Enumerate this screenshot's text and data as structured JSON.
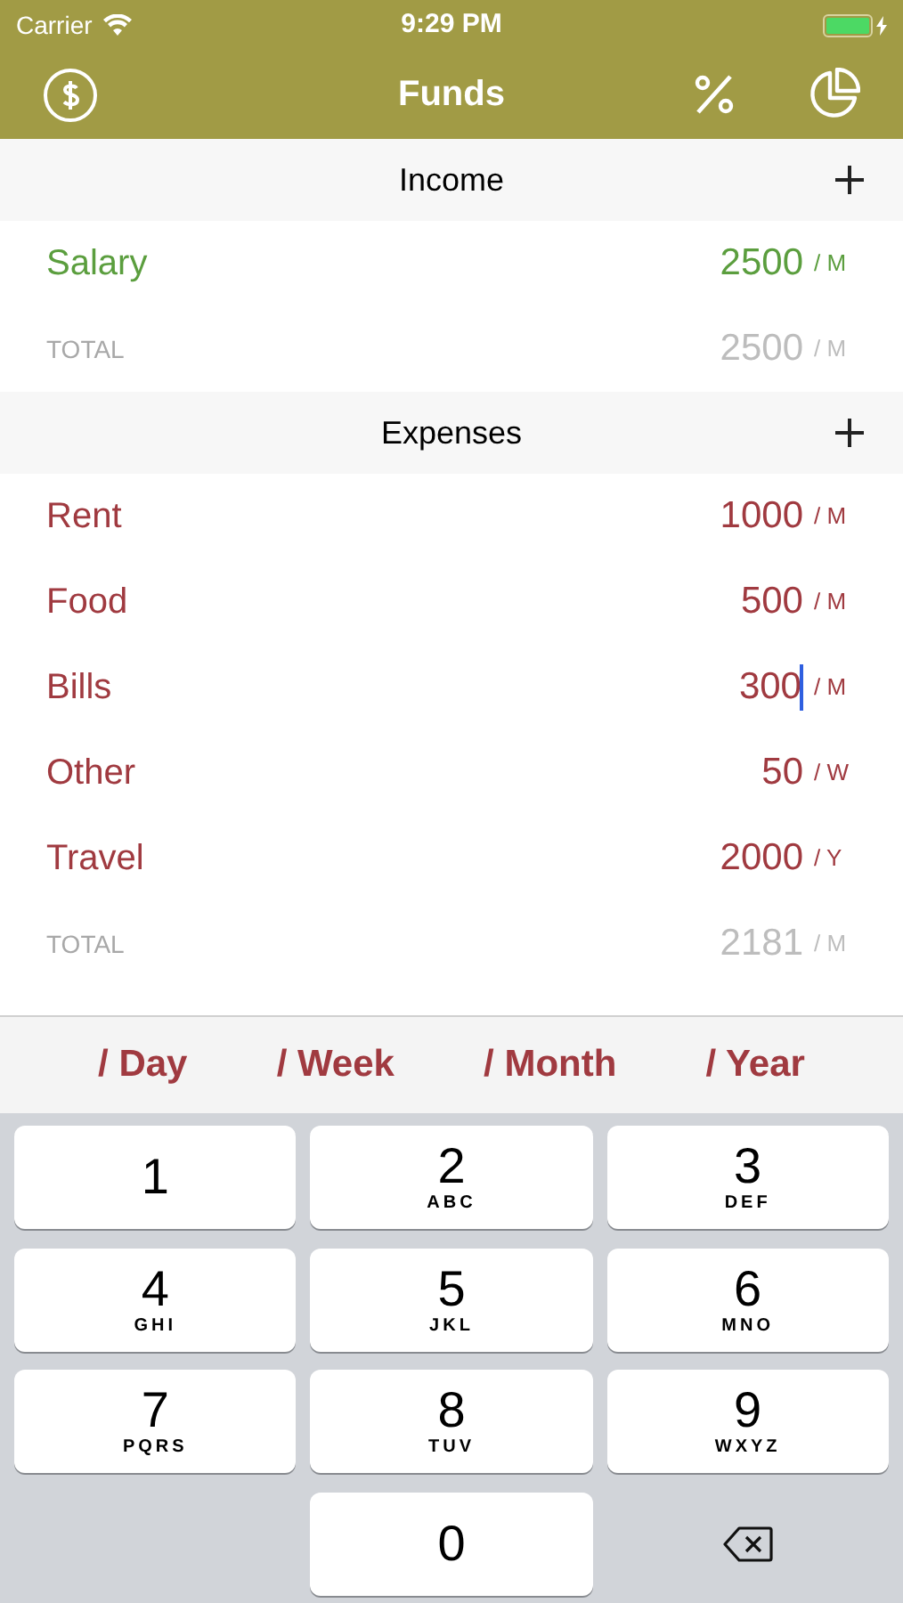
{
  "status_bar": {
    "carrier": "Carrier",
    "time": "9:29 PM"
  },
  "nav": {
    "title": "Funds"
  },
  "sections": [
    {
      "title": "Income",
      "color": "#5b9e3e",
      "items": [
        {
          "name": "Salary",
          "amount": "2500",
          "unit": "/ M",
          "focused": false
        }
      ],
      "total": {
        "label": "TOTAL",
        "amount": "2500",
        "unit": "/ M"
      }
    },
    {
      "title": "Expenses",
      "color": "#a03a40",
      "items": [
        {
          "name": "Rent",
          "amount": "1000",
          "unit": "/ M",
          "focused": false
        },
        {
          "name": "Food",
          "amount": "500",
          "unit": "/ M",
          "focused": false
        },
        {
          "name": "Bills",
          "amount": "300",
          "unit": "/ M",
          "focused": true
        },
        {
          "name": "Other",
          "amount": "50",
          "unit": "/ W",
          "focused": false
        },
        {
          "name": "Travel",
          "amount": "2000",
          "unit": "/ Y",
          "focused": false
        }
      ],
      "total": {
        "label": "TOTAL",
        "amount": "2181",
        "unit": "/ M"
      }
    }
  ],
  "period_bar": [
    "/ Day",
    "/ Week",
    "/ Month",
    "/ Year"
  ],
  "keyboard": [
    {
      "kind": "digit",
      "digit": "1"
    },
    {
      "kind": "digit",
      "digit": "2",
      "letters": "ABC"
    },
    {
      "kind": "digit",
      "digit": "3",
      "letters": "DEF"
    },
    {
      "kind": "digit",
      "digit": "4",
      "letters": "GHI"
    },
    {
      "kind": "digit",
      "digit": "5",
      "letters": "JKL"
    },
    {
      "kind": "digit",
      "digit": "6",
      "letters": "MNO"
    },
    {
      "kind": "digit",
      "digit": "7",
      "letters": "PQRS"
    },
    {
      "kind": "digit",
      "digit": "8",
      "letters": "TUV"
    },
    {
      "kind": "digit",
      "digit": "9",
      "letters": "WXYZ"
    },
    {
      "kind": "blank"
    },
    {
      "kind": "digit",
      "digit": "0"
    },
    {
      "kind": "delete"
    }
  ]
}
